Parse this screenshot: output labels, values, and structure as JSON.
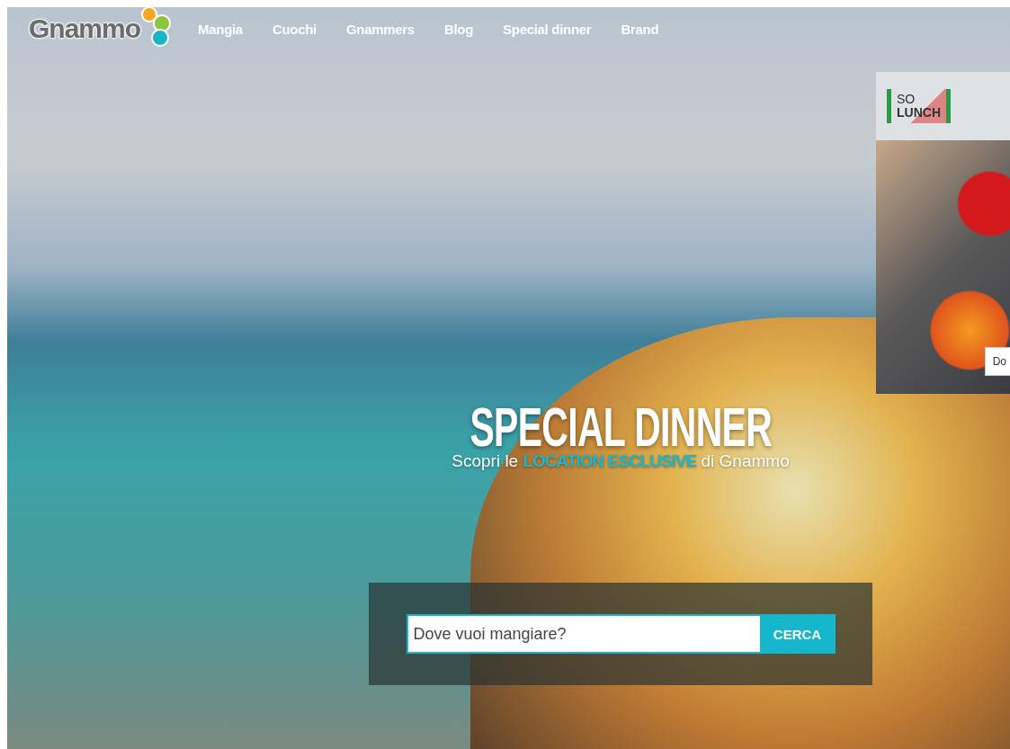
{
  "header": {
    "logo": "Gnammo",
    "nav": [
      {
        "label": "Mangia"
      },
      {
        "label": "Cuochi"
      },
      {
        "label": "Gnammers"
      },
      {
        "label": "Blog"
      },
      {
        "label": "Special dinner"
      },
      {
        "label": "Brand"
      }
    ]
  },
  "hero": {
    "title": "SPECIAL DINNER",
    "subtitle": {
      "before": "Scopri le ",
      "highlight": "LOCATION ESCLUSIVE",
      "after": " di Gnammo"
    },
    "search": {
      "placeholder": "Dove vuoi mangiare?",
      "button": "CERCA"
    }
  },
  "ad": {
    "logo_top": "SO",
    "logo_bottom": "LUNCH",
    "button": "Do"
  }
}
